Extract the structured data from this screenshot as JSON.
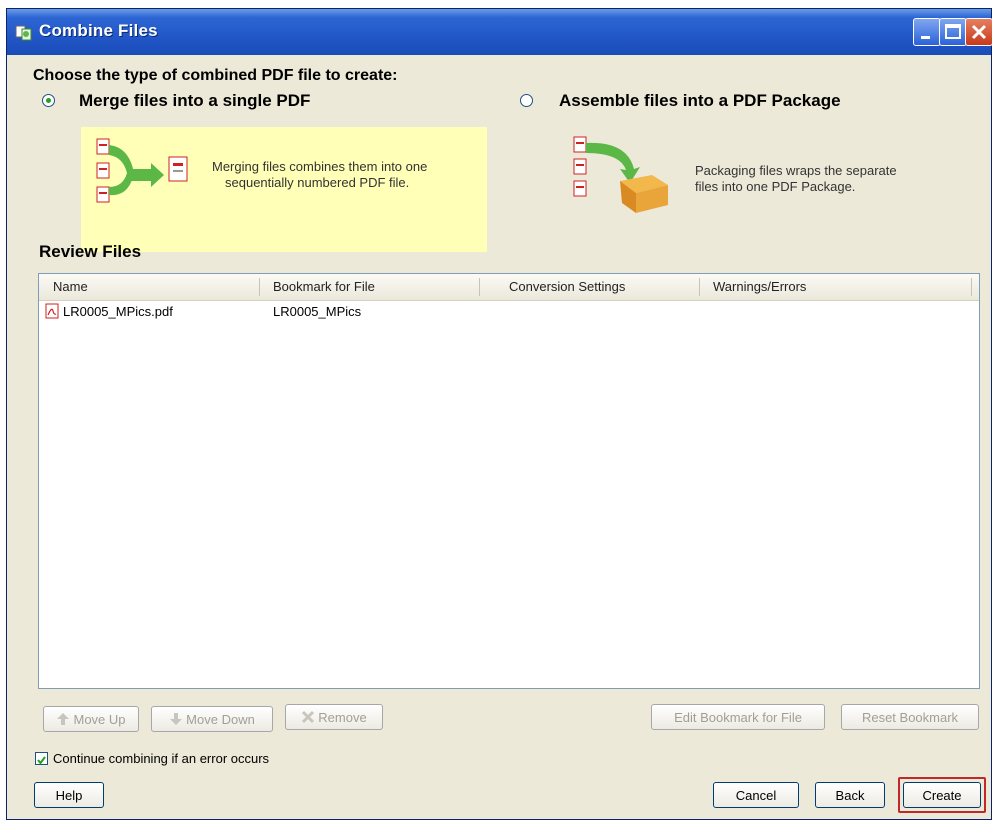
{
  "window": {
    "title": "Combine Files",
    "controls": {
      "minimize_icon": "minimize-icon",
      "maximize_icon": "maximize-icon",
      "close_icon": "close-icon"
    }
  },
  "type_section": {
    "heading": "Choose the type of combined PDF file to create:",
    "options": [
      {
        "label": "Merge files into a single PDF",
        "selected": true,
        "description_line1": "Merging files combines them into one",
        "description_line2": "sequentially numbered PDF file."
      },
      {
        "label": "Assemble files into a PDF Package",
        "selected": false,
        "description_line1": "Packaging files wraps the separate",
        "description_line2": "files into one PDF Package."
      }
    ]
  },
  "review": {
    "title": "Review Files",
    "columns": [
      "Name",
      "Bookmark for File",
      "Conversion Settings",
      "Warnings/Errors"
    ],
    "rows": [
      {
        "name": "LR0005_MPics.pdf",
        "bookmark": "LR0005_MPics",
        "conversion": "",
        "warnings": ""
      }
    ]
  },
  "list_buttons": {
    "move_up": "Move Up",
    "move_down": "Move Down",
    "remove": "Remove",
    "edit_bookmark": "Edit Bookmark for File",
    "reset_bookmark": "Reset Bookmark"
  },
  "continue_checkbox": {
    "label": "Continue combining if an error occurs",
    "checked": true
  },
  "footer": {
    "help": "Help",
    "cancel": "Cancel",
    "back": "Back",
    "create": "Create"
  },
  "colors": {
    "title_bar": "#2257c8",
    "panel_highlight": "#ffffb8",
    "create_highlight": "#c0282a"
  }
}
